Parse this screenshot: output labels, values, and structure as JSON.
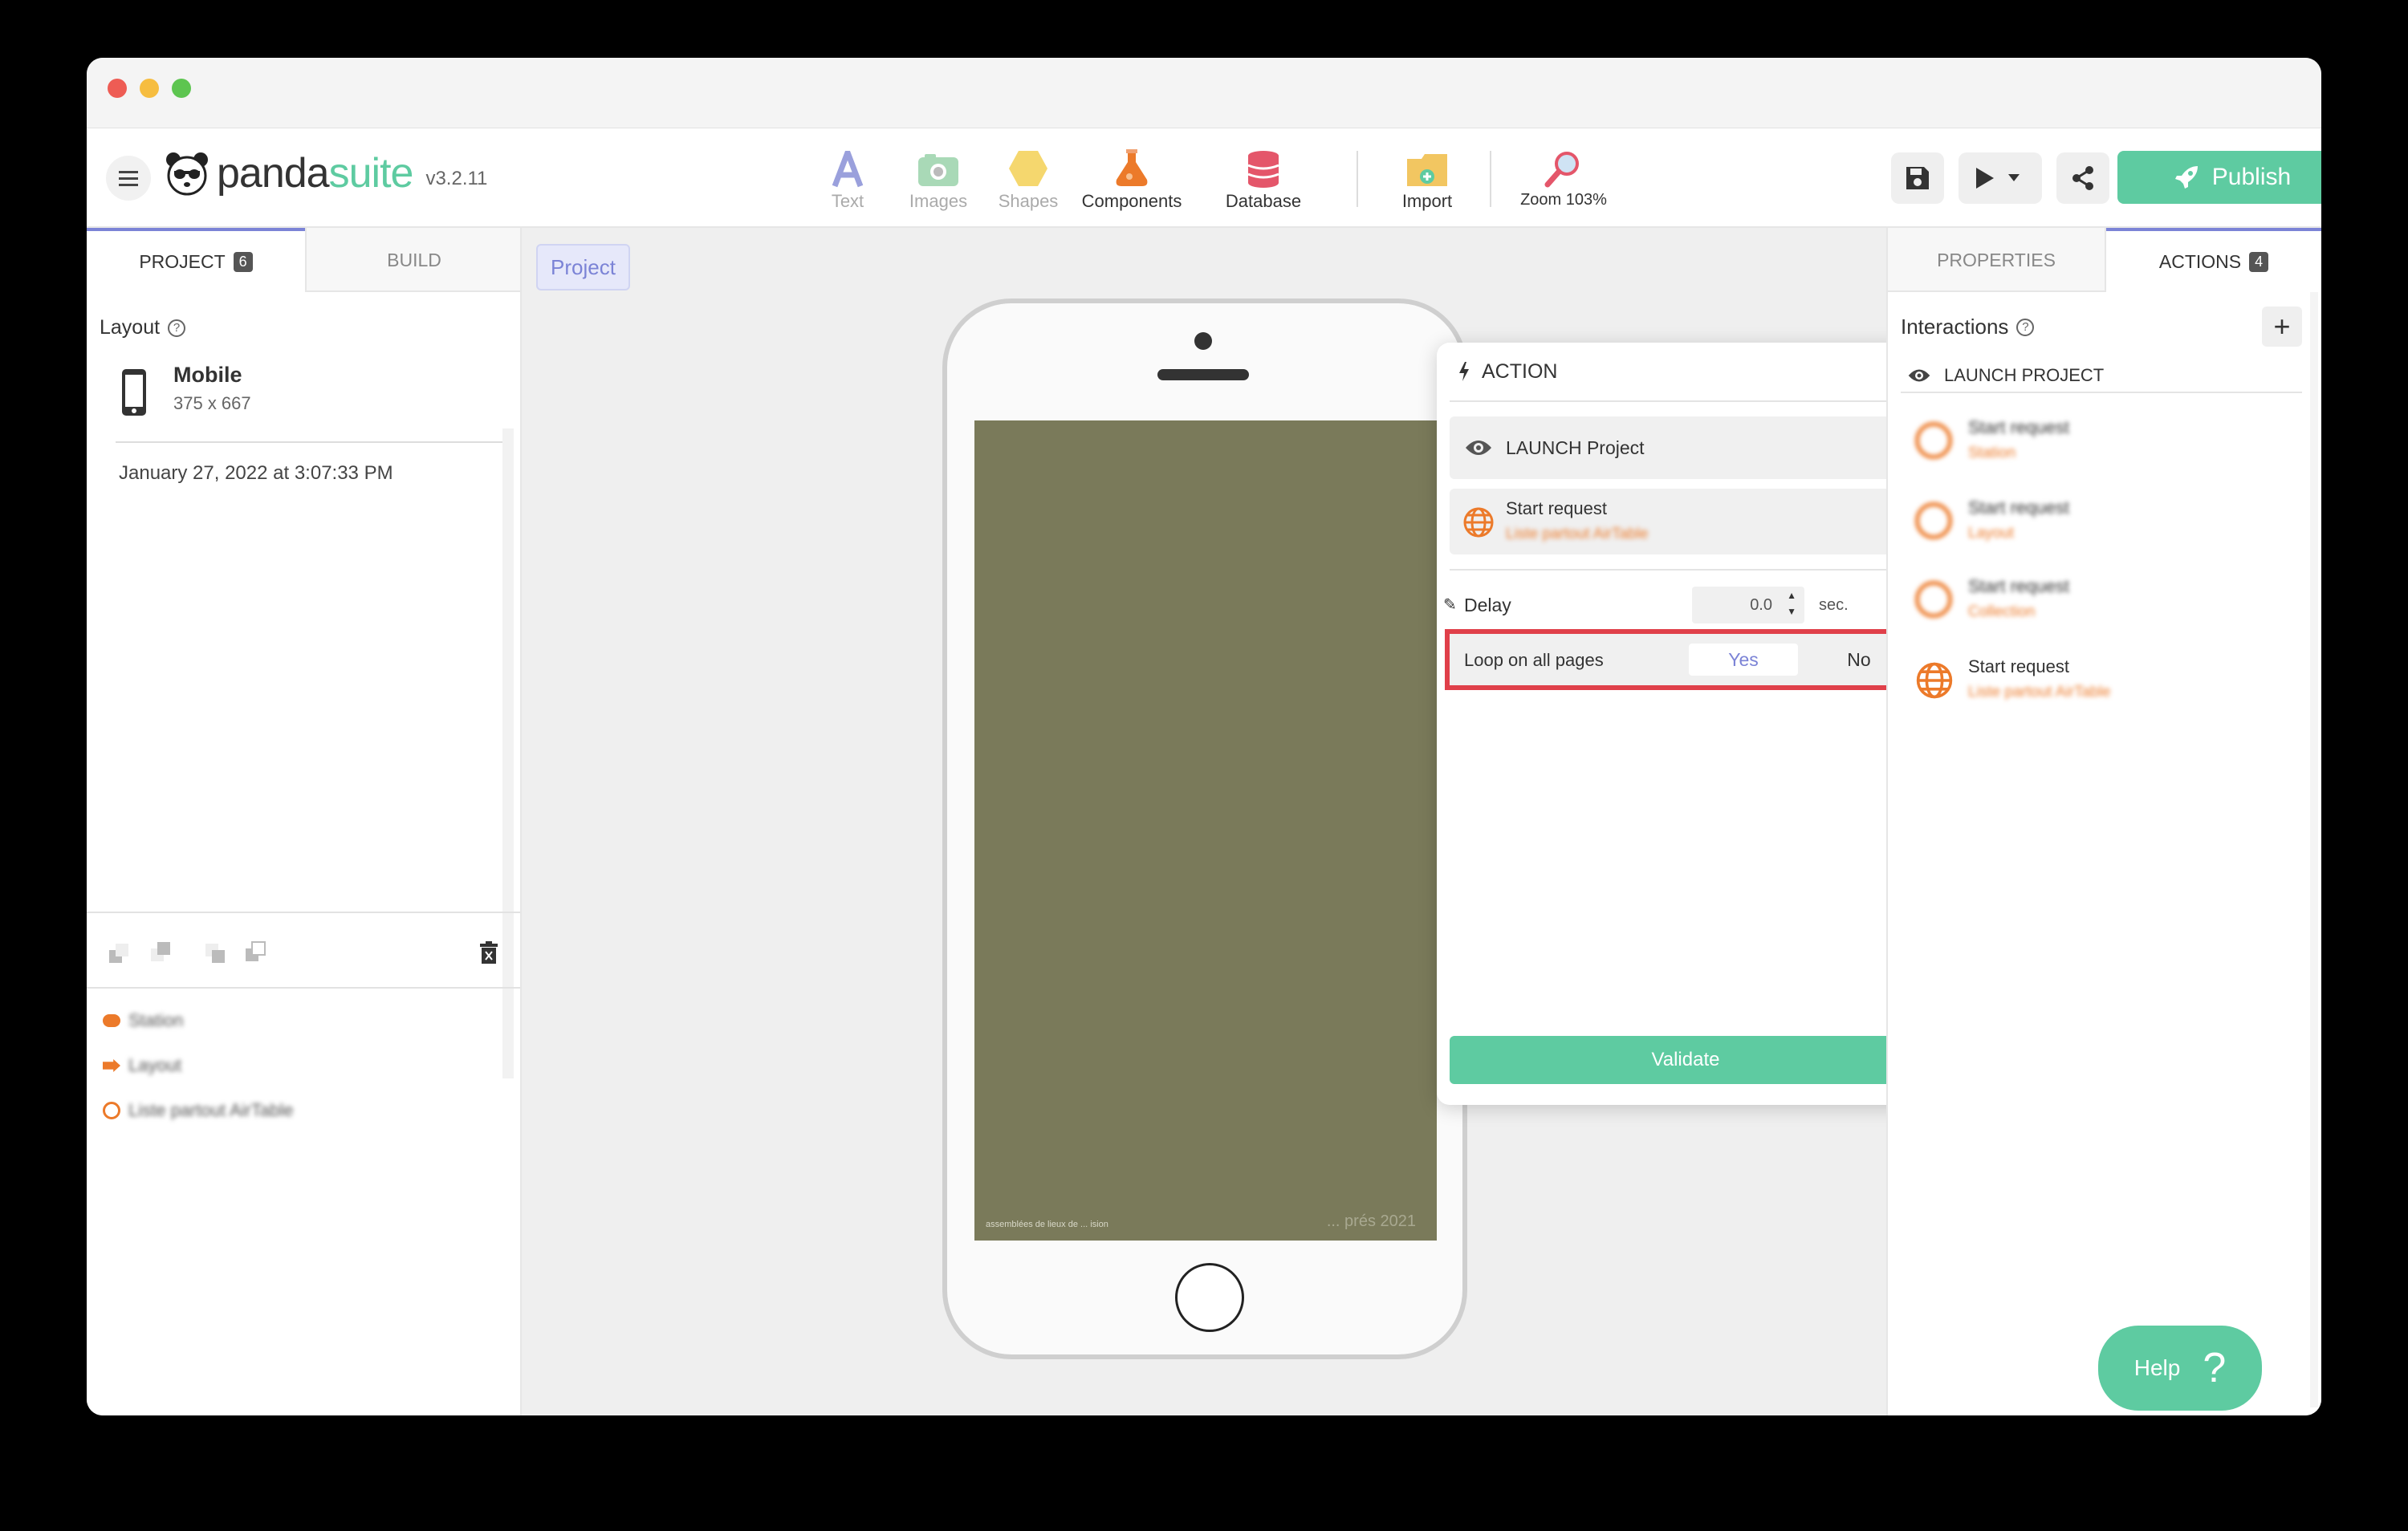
{
  "toolbar": {
    "version": "v3.2.11",
    "tools": {
      "text": "Text",
      "images": "Images",
      "shapes": "Shapes",
      "components": "Components",
      "database": "Database",
      "import": "Import",
      "zoom": "Zoom 103%"
    },
    "publish": "Publish"
  },
  "left_panel": {
    "tab_project": "PROJECT",
    "tab_project_count": "6",
    "tab_build": "BUILD",
    "layout_heading": "Layout",
    "layout_name": "Mobile",
    "layout_size": "375 x 667",
    "date": "January 27, 2022 at 3:07:33 PM",
    "items": [
      "Station",
      "Layout",
      "Liste partout AirTable"
    ]
  },
  "canvas": {
    "breadcrumb": "Project",
    "phone_footer_left": "assemblées de lieux de ... ision",
    "phone_footer_right": "... prés 2021"
  },
  "action_dialog": {
    "title": "ACTION",
    "launch_label": "LAUNCH Project",
    "request_title": "Start request",
    "request_sub": "Liste partout AirTable",
    "delay_label": "Delay",
    "delay_value": "0.0",
    "delay_unit": "sec.",
    "loop_label": "Loop on all pages",
    "loop_yes": "Yes",
    "loop_no": "No",
    "validate": "Validate"
  },
  "right_panel": {
    "tab_properties": "PROPERTIES",
    "tab_actions": "ACTIONS",
    "tab_actions_count": "4",
    "heading": "Interactions",
    "launch_header": "LAUNCH PROJECT",
    "items": [
      {
        "title": "Start request",
        "sub": "Station"
      },
      {
        "title": "Start request",
        "sub": "Layout"
      },
      {
        "title": "Start request",
        "sub": "Collection"
      },
      {
        "title": "Start request",
        "sub": "Liste partout AirTable"
      }
    ],
    "help": "Help"
  },
  "colors": {
    "accent_green": "#5ecba1",
    "accent_purple": "#7b83d6",
    "orange": "#ec7a2a",
    "highlight_red": "#e0404a",
    "phone_screen": "#7a7a5a"
  }
}
